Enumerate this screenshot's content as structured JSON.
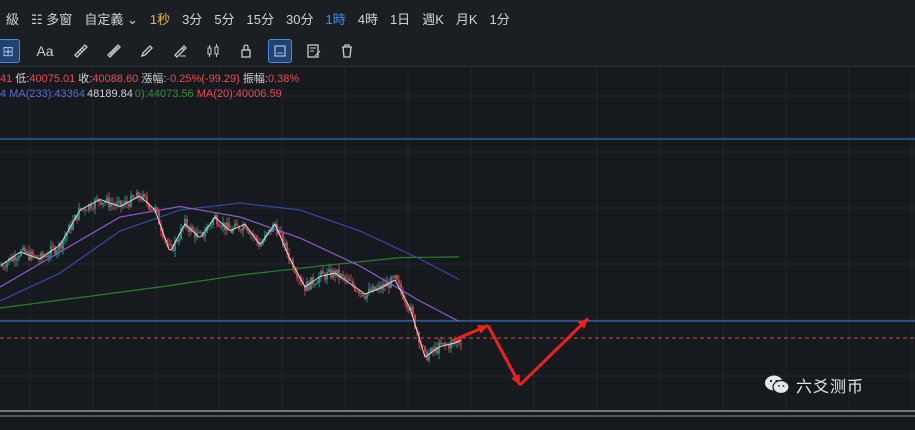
{
  "topbar": {
    "items": [
      {
        "label": "級",
        "state": "normal"
      },
      {
        "label": "多窗",
        "state": "normal"
      },
      {
        "label": "自定義",
        "state": "normal"
      },
      {
        "label": "1秒",
        "state": "gold"
      },
      {
        "label": "3分",
        "state": "normal"
      },
      {
        "label": "5分",
        "state": "normal"
      },
      {
        "label": "15分",
        "state": "normal"
      },
      {
        "label": "30分",
        "state": "normal"
      },
      {
        "label": "1時",
        "state": "active"
      },
      {
        "label": "4時",
        "state": "normal"
      },
      {
        "label": "1日",
        "state": "normal"
      },
      {
        "label": "週K",
        "state": "normal"
      },
      {
        "label": "月K",
        "state": "normal"
      },
      {
        "label": "1分",
        "state": "normal"
      }
    ]
  },
  "toolbar": {
    "tools": [
      {
        "icon": "add-icon",
        "active": true
      },
      {
        "icon": "text-icon",
        "label": "Aa",
        "active": false
      },
      {
        "icon": "ruler-icon",
        "active": false
      },
      {
        "icon": "measure-icon",
        "active": false
      },
      {
        "icon": "pencil-icon",
        "active": false
      },
      {
        "icon": "brush-icon",
        "active": false
      },
      {
        "icon": "candles-icon",
        "active": false
      },
      {
        "icon": "lock-icon",
        "active": false
      },
      {
        "icon": "magnet-icon",
        "active": true
      },
      {
        "icon": "edit-list-icon",
        "active": false
      },
      {
        "icon": "trash-icon",
        "active": false
      }
    ]
  },
  "legend": {
    "prefix_value": "41",
    "low_label": "低:",
    "low_value": "40075.01",
    "close_label": "收:",
    "close_value": "40088.60",
    "change_label": "漲幅:",
    "change_value": "-0.25%(-99.29)",
    "amp_label": "振幅:",
    "amp_value": "0.38%",
    "ma233_label": "MA(233):43364",
    "price_tag": "48189.84",
    "ma120_tail": "0):44073.56",
    "ma20_label": "MA(20):40006.59",
    "ma_left_frag": "4"
  },
  "watermark": {
    "text": "六爻测币"
  },
  "colors": {
    "background": "#161a1e",
    "up": "#26a69a",
    "down": "#e74c57",
    "ma20": "#d9d9d9",
    "ma_blue": "#3348a6",
    "ma_purple": "#8a5cc8",
    "ma_green": "#2e7d2e",
    "hline": "#3d7fd6",
    "arrow": "#e8231f",
    "active": "#3d8ef0"
  },
  "chart_data": {
    "type": "candlestick",
    "interval": "1時",
    "horizontal_levels": [
      "upper-resistance",
      "lower-support"
    ],
    "dashed_level": "current-price",
    "price_path": [
      [
        0,
        40.0
      ],
      [
        20,
        42.0
      ],
      [
        40,
        41.0
      ],
      [
        60,
        43.0
      ],
      [
        80,
        48.0
      ],
      [
        100,
        49.5
      ],
      [
        120,
        48.5
      ],
      [
        140,
        50.0
      ],
      [
        155,
        48.0
      ],
      [
        170,
        42.0
      ],
      [
        185,
        46.0
      ],
      [
        200,
        44.0
      ],
      [
        215,
        47.0
      ],
      [
        230,
        45.0
      ],
      [
        245,
        46.0
      ],
      [
        260,
        43.0
      ],
      [
        275,
        46.0
      ],
      [
        290,
        41.0
      ],
      [
        305,
        37.0
      ],
      [
        320,
        38.5
      ],
      [
        335,
        39.0
      ],
      [
        350,
        37.5
      ],
      [
        365,
        36.0
      ],
      [
        380,
        36.8
      ],
      [
        395,
        38.0
      ],
      [
        410,
        34.0
      ],
      [
        425,
        27.0
      ],
      [
        440,
        28.5
      ],
      [
        455,
        29.0
      ],
      [
        462,
        29.5
      ]
    ],
    "ma_blue_path": [
      [
        0,
        35
      ],
      [
        60,
        39
      ],
      [
        120,
        45
      ],
      [
        180,
        48
      ],
      [
        240,
        49
      ],
      [
        300,
        48
      ],
      [
        360,
        45
      ],
      [
        420,
        41
      ],
      [
        460,
        38
      ]
    ],
    "ma_purple_path": [
      [
        0,
        37
      ],
      [
        60,
        42
      ],
      [
        120,
        47
      ],
      [
        180,
        48.5
      ],
      [
        240,
        47
      ],
      [
        300,
        44
      ],
      [
        360,
        40
      ],
      [
        420,
        35
      ],
      [
        460,
        32
      ]
    ],
    "ma_green_path": [
      [
        0,
        34
      ],
      [
        80,
        35.5
      ],
      [
        160,
        37
      ],
      [
        240,
        38.7
      ],
      [
        320,
        40
      ],
      [
        400,
        41.2
      ],
      [
        460,
        41.3
      ]
    ],
    "projection_arrows": [
      {
        "from": [
          452,
          29.3
        ],
        "to": [
          488,
          31.5
        ]
      },
      {
        "from": [
          488,
          31.5
        ],
        "to": [
          520,
          23.0
        ]
      },
      {
        "from": [
          520,
          23.0
        ],
        "to": [
          588,
          32.5
        ]
      }
    ]
  }
}
